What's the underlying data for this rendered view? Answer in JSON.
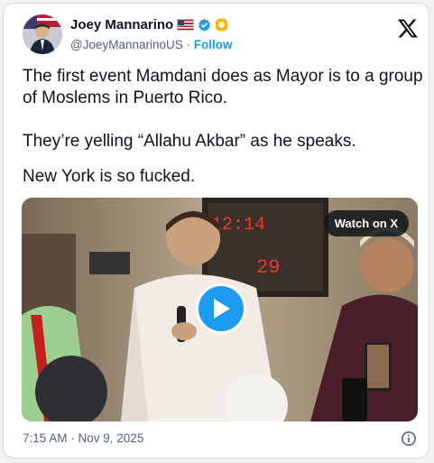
{
  "author": {
    "name": "Joey Mannarino",
    "handle": "@JoeyMannarinoUS",
    "separator": "·",
    "follow_label": "Follow"
  },
  "tweet": {
    "lines": [
      "The first event Mamdani does as Mayor is to a group",
      "of Moslems in Puerto Rico.",
      "They’re yelling “Allahu Akbar” as he speaks.",
      "New York is so fucked."
    ]
  },
  "media": {
    "watch_label": "Watch on X",
    "clock_digits": "29"
  },
  "footer": {
    "timestamp": "7:15 AM · Nov 9, 2025"
  },
  "colors": {
    "accent": "#1d9bf0",
    "text": "#0f1419",
    "muted": "#536471"
  },
  "icons": [
    "x-logo-icon",
    "verified-badge-icon",
    "gold-badge-icon",
    "play-icon",
    "info-icon"
  ]
}
